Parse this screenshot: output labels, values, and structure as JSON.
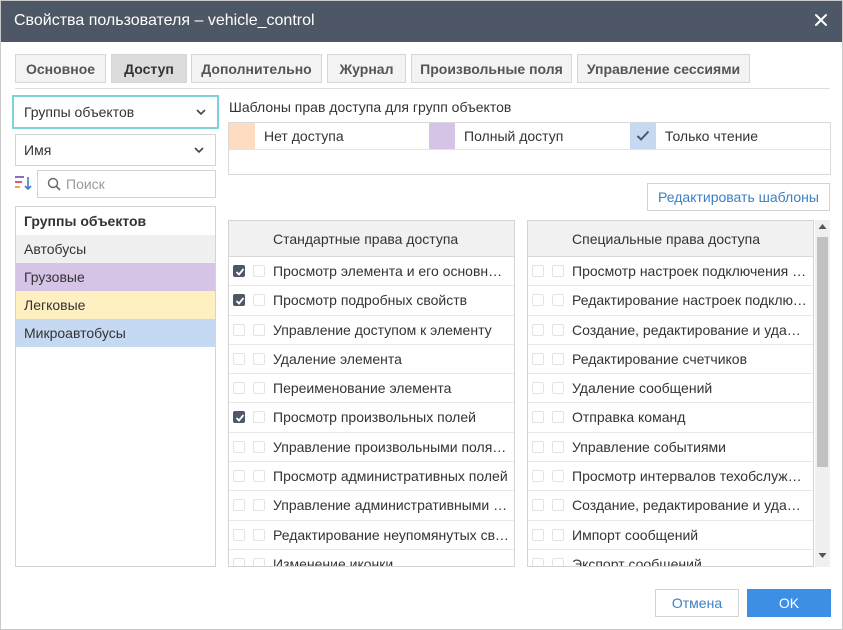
{
  "window": {
    "title": "Свойства пользователя – vehicle_control",
    "close_icon": "close-icon"
  },
  "tabs": [
    {
      "label": "Основное",
      "active": false
    },
    {
      "label": "Доступ",
      "active": true
    },
    {
      "label": "Дополнительно",
      "active": false
    },
    {
      "label": "Журнал",
      "active": false
    },
    {
      "label": "Произвольные поля",
      "active": false
    },
    {
      "label": "Управление сессиями",
      "active": false
    }
  ],
  "left": {
    "object_type_select": "Группы объектов",
    "sort_field_select": "Имя",
    "search_placeholder": "Поиск",
    "list_header": "Группы объектов",
    "groups": [
      {
        "label": "Автобусы",
        "color": "#f0f0f0"
      },
      {
        "label": "Грузовые",
        "color": "#d5c4e6"
      },
      {
        "label": "Легковые",
        "color": "#fff0c2"
      },
      {
        "label": "Микроавтобусы",
        "color": "#c6d9f2"
      }
    ]
  },
  "templates": {
    "label": "Шаблоны прав доступа для групп объектов",
    "items": [
      {
        "label": "Нет доступа",
        "color": "#fddcc2",
        "checked": false
      },
      {
        "label": "Полный доступ",
        "color": "#d5c4e6",
        "checked": false
      },
      {
        "label": "Только чтение",
        "color": "#c6d9f2",
        "checked": true
      }
    ],
    "edit_button": "Редактировать шаблоны"
  },
  "standard_rights": {
    "header": "Стандартные права доступа",
    "rows": [
      {
        "label": "Просмотр элемента и его основных свойств",
        "checked": true
      },
      {
        "label": "Просмотр подробных свойств",
        "checked": true
      },
      {
        "label": "Управление доступом к элементу",
        "checked": false
      },
      {
        "label": "Удаление элемента",
        "checked": false
      },
      {
        "label": "Переименование элемента",
        "checked": false
      },
      {
        "label": "Просмотр произвольных полей",
        "checked": true
      },
      {
        "label": "Управление произвольными полями",
        "checked": false
      },
      {
        "label": "Просмотр административных полей",
        "checked": false
      },
      {
        "label": "Управление административными полями",
        "checked": false
      },
      {
        "label": "Редактирование неупомянутых свойств",
        "checked": false
      },
      {
        "label": "Изменение иконки",
        "checked": false
      }
    ]
  },
  "special_rights": {
    "header": "Специальные права доступа",
    "rows": [
      {
        "label": "Просмотр настроек подключения и датчиков",
        "checked": false
      },
      {
        "label": "Редактирование настроек подключения",
        "checked": false
      },
      {
        "label": "Создание, редактирование и удаление датчиков",
        "checked": false
      },
      {
        "label": "Редактирование счетчиков",
        "checked": false
      },
      {
        "label": "Удаление сообщений",
        "checked": false
      },
      {
        "label": "Отправка команд",
        "checked": false
      },
      {
        "label": "Управление событиями",
        "checked": false
      },
      {
        "label": "Просмотр интервалов техобслуживания",
        "checked": false
      },
      {
        "label": "Создание, редактирование и удаление интервалов",
        "checked": false
      },
      {
        "label": "Импорт сообщений",
        "checked": false
      },
      {
        "label": "Экспорт сообщений",
        "checked": false
      }
    ]
  },
  "footer": {
    "cancel": "Отмена",
    "ok": "OK"
  },
  "colors": {
    "titlebar": "#4d5766",
    "accent": "#3d8fe6",
    "link": "#3d7fc4",
    "focus": "#7fd1d8"
  }
}
